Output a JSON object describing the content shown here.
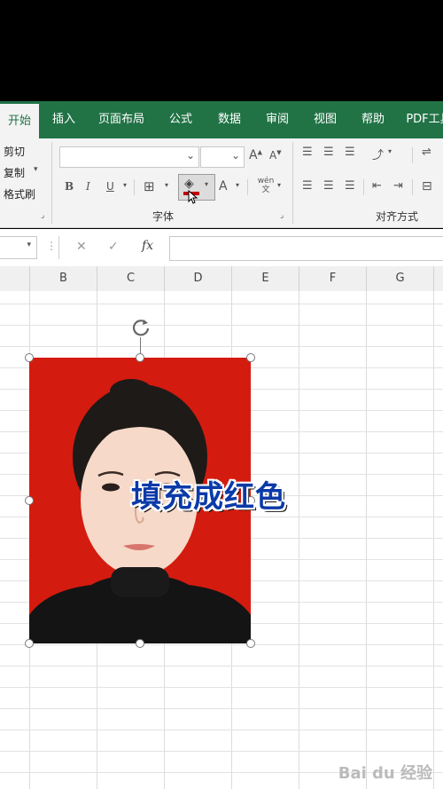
{
  "tabs": [
    "开始",
    "插入",
    "页面布局",
    "公式",
    "数据",
    "审阅",
    "视图",
    "帮助",
    "PDF工具"
  ],
  "clipboard": {
    "cut": "剪切",
    "copy": "复制",
    "format_painter": "格式刷"
  },
  "font_group": {
    "label": "字体",
    "bold": "B",
    "italic": "I",
    "underline": "U",
    "font_color": "A",
    "grow_font": "A",
    "shrink_font": "A",
    "phonetic": "wén文"
  },
  "alignment_group": {
    "label": "对齐方式"
  },
  "formula_bar": {
    "fx": "fx",
    "cancel": "✕",
    "enter": "✓"
  },
  "columns": [
    "B",
    "C",
    "D",
    "E",
    "F",
    "G"
  ],
  "caption": "填充成红色",
  "watermark": "Bai du 经验",
  "colors": {
    "ribbon_green": "#217346",
    "photo_background": "#d41b0f",
    "fill_color_bar": "#c00000",
    "caption_text": "#0b3aa8"
  }
}
